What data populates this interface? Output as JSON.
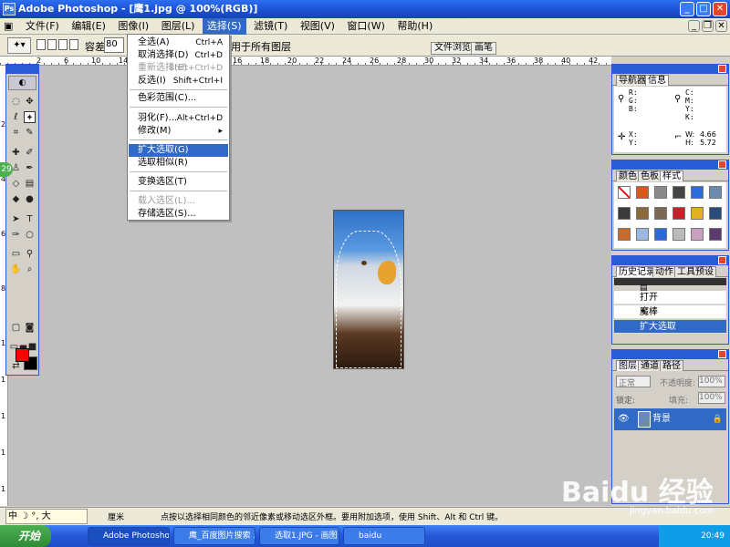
{
  "window": {
    "title": "Adobe Photoshop - [鹰1.jpg @ 100%(RGB)]"
  },
  "menubar": {
    "items": [
      "文件(F)",
      "编辑(E)",
      "图像(I)",
      "图层(L)",
      "选择(S)",
      "滤镜(T)",
      "视图(V)",
      "窗口(W)",
      "帮助(H)"
    ]
  },
  "options": {
    "tolerance_label": "容差:",
    "tolerance_value": "80",
    "sample_all_text": "用于所有图层",
    "file_browser": "文件浏览器",
    "brushes": "画笔"
  },
  "rulers": {
    "h": [
      "2",
      "4",
      "6",
      "8",
      "10",
      "12",
      "14",
      "16",
      "18",
      "20",
      "22",
      "24",
      "26",
      "28",
      "30",
      "32",
      "34",
      "36",
      "38",
      "40",
      "42",
      "44",
      "46"
    ],
    "v": [
      "2",
      "4",
      "6",
      "8",
      "1",
      "1",
      "1",
      "1",
      "1"
    ]
  },
  "select_menu": {
    "items": [
      {
        "label": "全选(A)",
        "shortcut": "Ctrl+A"
      },
      {
        "label": "取消选择(D)",
        "shortcut": "Ctrl+D"
      },
      {
        "label": "重新选择(E)",
        "shortcut": "Shift+Ctrl+D"
      },
      {
        "label": "反选(I)",
        "shortcut": "Shift+Ctrl+I"
      },
      {
        "label": "色彩范围(C)...",
        "shortcut": ""
      },
      {
        "label": "羽化(F)...",
        "shortcut": "Alt+Ctrl+D"
      },
      {
        "label": "修改(M)",
        "shortcut": "▸"
      },
      {
        "label": "扩大选取(G)",
        "shortcut": ""
      },
      {
        "label": "选取相似(R)",
        "shortcut": ""
      },
      {
        "label": "变换选区(T)",
        "shortcut": ""
      },
      {
        "label": "载入选区(L)...",
        "shortcut": ""
      },
      {
        "label": "存储选区(S)...",
        "shortcut": ""
      }
    ]
  },
  "navigator": {
    "tabs": [
      "导航器",
      "信息"
    ],
    "rgb": "R:\nG:\nB:",
    "cmyk": "C:\nM:\nY:\nK:",
    "xy": "X:\nY:",
    "w": "W:",
    "w_val": "4.66",
    "h": "H:",
    "h_val": "5.72"
  },
  "color_panel": {
    "tabs": [
      "颜色",
      "色板",
      "样式"
    ]
  },
  "history": {
    "tabs": [
      "历史记录",
      "动作",
      "工具预设"
    ],
    "rows": [
      "打开",
      "魔棒",
      "扩大选取"
    ]
  },
  "layers": {
    "tabs": [
      "图层",
      "通道",
      "路径"
    ],
    "mode": "正常",
    "opacity_label": "不透明度:",
    "opacity": "100%",
    "lock_label": "锁定:",
    "fill_label": "填充:",
    "fill": "100%",
    "layer_name": "背景"
  },
  "status": {
    "ime": "中 ☽ °, 大",
    "unit": "厘米",
    "hint": "点按以选择相同颜色的邻近像素或移动选区外框。要用附加选项，使用 Shift、Alt 和 Ctrl 键。"
  },
  "taskbar": {
    "start": "开始",
    "tasks": [
      "Adobe Photoshop ...",
      "鹰_百度图片搜索 ...",
      "选取1.JPG - 画图",
      "baidu"
    ],
    "time": "20:49"
  },
  "watermark": {
    "brand": "Baidu 经验",
    "url": "jingyan.baidu.com"
  },
  "styles_colors": [
    "#ffffff",
    "#d85a1a",
    "#8a8a8a",
    "#444444",
    "#2a6cd8",
    "#6a8ab0",
    "#3a3a3a",
    "#8a6a3a",
    "#7a6a55",
    "#c8202a",
    "#e0b020",
    "#2a4a7a",
    "#c86a2a",
    "#9ab8e0",
    "#2a6ad8",
    "#bbbbbb",
    "#caa0c0",
    "#5a3a70"
  ]
}
